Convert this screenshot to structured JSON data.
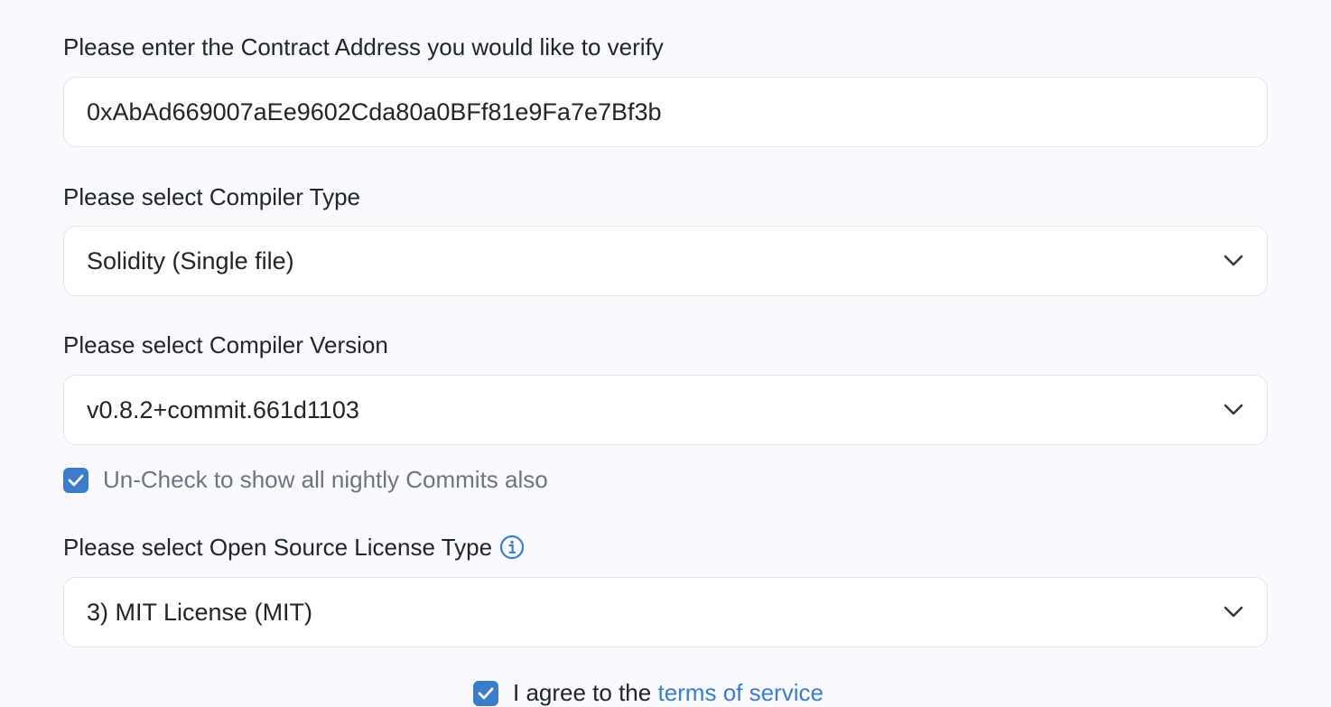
{
  "form": {
    "address": {
      "label": "Please enter the Contract Address you would like to verify",
      "value": "0xAbAd669007aEe9602Cda80a0BFf81e9Fa7e7Bf3b"
    },
    "compiler_type": {
      "label": "Please select Compiler Type",
      "selected": "Solidity (Single file)"
    },
    "compiler_version": {
      "label": "Please select Compiler Version",
      "selected": "v0.8.2+commit.661d1103"
    },
    "nightly": {
      "label": "Un-Check to show all nightly Commits also",
      "checked": true
    },
    "license": {
      "label": "Please select Open Source License Type",
      "selected": "3) MIT License (MIT)"
    },
    "terms": {
      "prefix": "I agree to the",
      "link": "terms of service",
      "checked": true
    }
  },
  "colors": {
    "accent": "#3d7cc9",
    "background": "#f8fafd",
    "field_border": "#e1e4ea",
    "muted_text": "#6c757d"
  },
  "icons": {
    "select_arrow": "chevron-down-icon",
    "info": "info-icon",
    "checkbox": "check-icon"
  }
}
